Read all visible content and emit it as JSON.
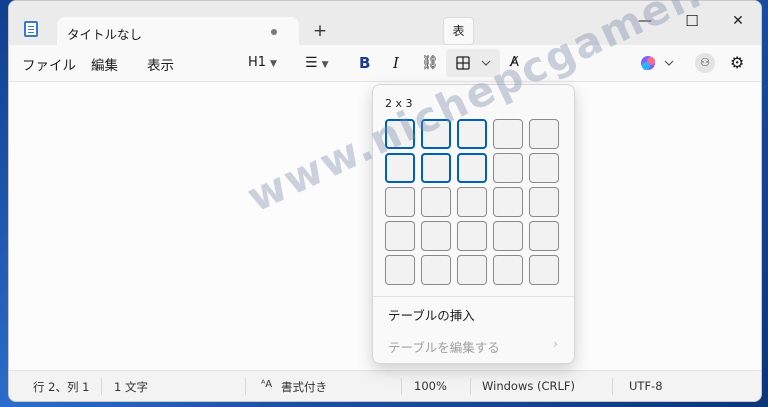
{
  "window": {
    "tab_title": "タイトルなし",
    "new_tab": "+",
    "minimize": "—",
    "maximize": "☐",
    "close": "✕"
  },
  "tooltip": "表",
  "menu": {
    "file": "ファイル",
    "edit": "編集",
    "view": "表示"
  },
  "toolbar": {
    "heading": "H1",
    "list_icon": "list-icon",
    "bold": "B",
    "italic": "I",
    "link_icon": "link-icon",
    "table_icon": "table-icon",
    "spell_icon": "spellcheck-icon",
    "copilot_icon": "copilot-icon",
    "account_icon": "account-icon",
    "settings_icon": "gear-icon"
  },
  "dropdown": {
    "size_label": "2 x 3",
    "grid_rows": 5,
    "grid_cols": 5,
    "selected_rows": 2,
    "selected_cols": 3,
    "insert_label": "テーブルの挿入",
    "edit_label": "テーブルを編集する"
  },
  "status": {
    "position": "行 2、列 1",
    "chars": "1 文字",
    "format": "書式付き",
    "zoom": "100%",
    "line_ending": "Windows (CRLF)",
    "encoding": "UTF-8"
  },
  "watermark": "www.nichepcgamer.com",
  "colors": {
    "accent": "#005fb8",
    "copilot": "#7b61ff"
  }
}
